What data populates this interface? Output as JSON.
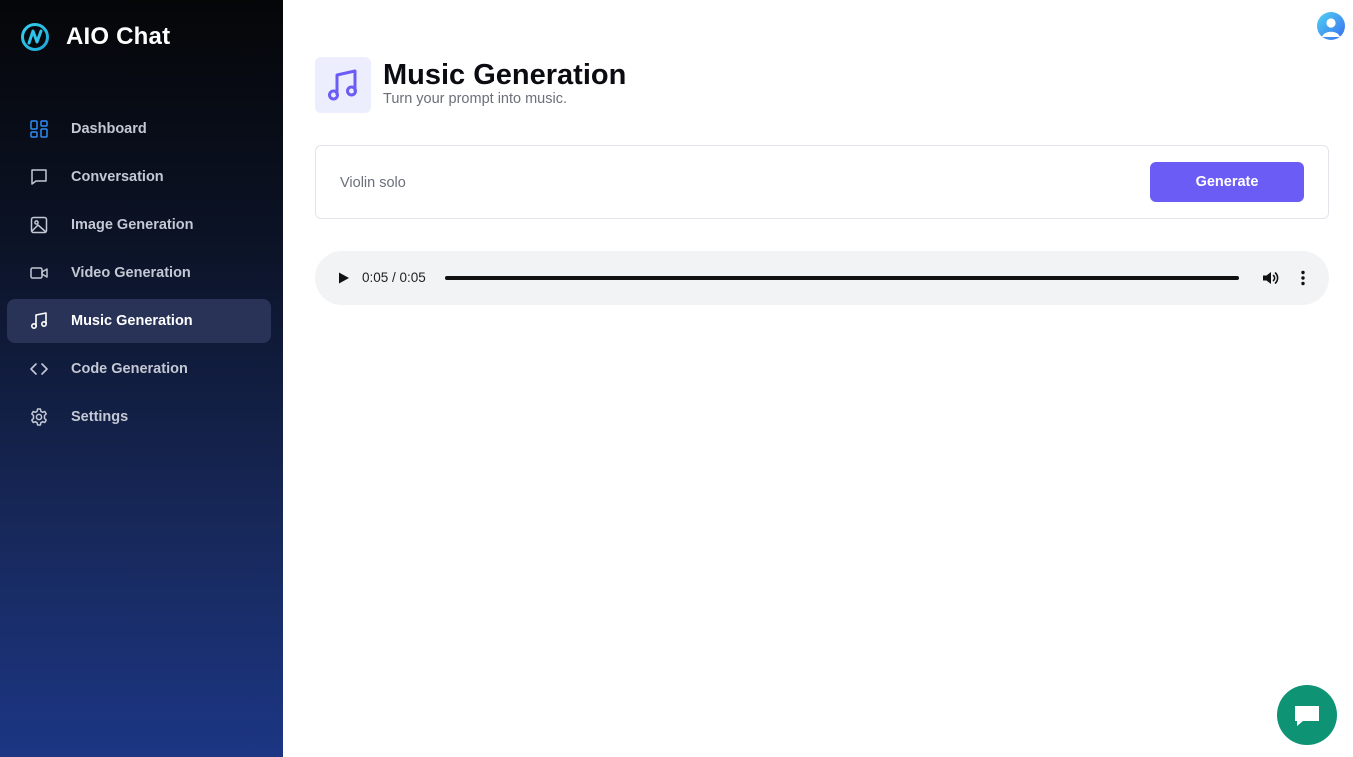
{
  "app": {
    "name": "AIO Chat"
  },
  "sidebar": {
    "items": [
      {
        "label": "Dashboard",
        "icon": "dashboard-icon",
        "active": false
      },
      {
        "label": "Conversation",
        "icon": "chat-icon",
        "active": false
      },
      {
        "label": "Image Generation",
        "icon": "image-icon",
        "active": false
      },
      {
        "label": "Video Generation",
        "icon": "video-icon",
        "active": false
      },
      {
        "label": "Music Generation",
        "icon": "music-icon",
        "active": true
      },
      {
        "label": "Code Generation",
        "icon": "code-icon",
        "active": false
      },
      {
        "label": "Settings",
        "icon": "gear-icon",
        "active": false
      }
    ]
  },
  "header": {
    "title": "Music Generation",
    "subtitle": "Turn your prompt into music.",
    "icon": "music-note-icon"
  },
  "prompt": {
    "value": "Violin solo",
    "button_label": "Generate"
  },
  "audio": {
    "time": "0:05 / 0:05",
    "progress_percent": 100
  },
  "colors": {
    "accent": "#6c5cf6",
    "dashboard_icon": "#2f8cf5",
    "chat_widget": "#0e9474",
    "sidebar_active": "#283357"
  }
}
